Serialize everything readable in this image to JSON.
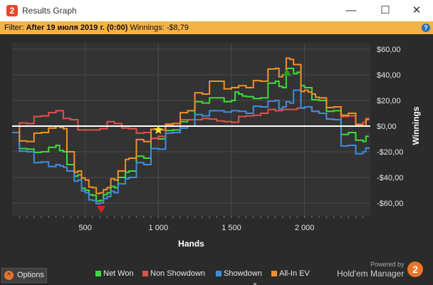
{
  "window": {
    "icon_label": "2",
    "title": "Results Graph",
    "minimize_glyph": "—",
    "maximize_glyph": "☐",
    "close_glyph": "✕"
  },
  "filter_bar": {
    "prefix": "Filter: ",
    "filter_value": "After 19 июля 2019 г. (0:00)",
    "winnings_label": " Winnings: ",
    "winnings_value": "-$8,79",
    "help_glyph": "?"
  },
  "options": {
    "label": "Options",
    "icon_glyph": "^"
  },
  "legend": [
    {
      "name": "Net Won",
      "color": "#3ddc3d"
    },
    {
      "name": "Non Showdown",
      "color": "#e0504a"
    },
    {
      "name": "Showdown",
      "color": "#3c8ee0"
    },
    {
      "name": "All-In EV",
      "color": "#f0902a"
    }
  ],
  "branding": {
    "powered_by": "Powered by",
    "product": "Hold'em Manager",
    "logo_glyph": "2"
  },
  "chart_data": {
    "type": "line",
    "xlabel": "Hands",
    "ylabel": "Winnings",
    "x_ticks": [
      500,
      1000,
      1500,
      2000
    ],
    "x_tick_labels": [
      "500",
      "1 000",
      "1 500",
      "2 000"
    ],
    "xlim": [
      0,
      2450
    ],
    "y_ticks": [
      60,
      40,
      20,
      0,
      -20,
      -40,
      -60
    ],
    "y_tick_labels": [
      "$60,00",
      "$40,00",
      "$20,00",
      "$0,00",
      "-$20,00",
      "-$40,00",
      "-$60,00"
    ],
    "ylim": [
      -70,
      65
    ],
    "grid": true,
    "zero_line": true,
    "series": [
      {
        "name": "Net Won",
        "color": "#3ddc3d",
        "x": [
          0,
          100,
          200,
          300,
          350,
          400,
          450,
          500,
          550,
          600,
          650,
          700,
          750,
          800,
          900,
          1000,
          1100,
          1200,
          1300,
          1400,
          1500,
          1550,
          1600,
          1700,
          1800,
          1850,
          1900,
          1950,
          2000,
          2100,
          2200,
          2300,
          2400,
          2440
        ],
        "y": [
          -5,
          -18,
          -20,
          -15,
          -20,
          -30,
          -38,
          -50,
          -54,
          -58,
          -52,
          -48,
          -40,
          -35,
          -25,
          -10,
          -3,
          5,
          18,
          22,
          20,
          25,
          23,
          22,
          35,
          30,
          45,
          42,
          30,
          20,
          12,
          -5,
          -12,
          -8
        ]
      },
      {
        "name": "Non Showdown",
        "color": "#e0504a",
        "x": [
          0,
          100,
          200,
          300,
          400,
          500,
          600,
          700,
          800,
          900,
          1000,
          1100,
          1200,
          1300,
          1400,
          1500,
          1600,
          1700,
          1800,
          1900,
          2000,
          2100,
          2200,
          2300,
          2400,
          2440
        ],
        "y": [
          0,
          2,
          8,
          12,
          5,
          -3,
          -2,
          2,
          -2,
          -5,
          -8,
          0,
          5,
          6,
          4,
          3,
          8,
          10,
          12,
          13,
          15,
          10,
          5,
          8,
          3,
          5
        ]
      },
      {
        "name": "Showdown",
        "color": "#3c8ee0",
        "x": [
          0,
          100,
          200,
          300,
          350,
          400,
          450,
          500,
          550,
          600,
          650,
          700,
          750,
          800,
          900,
          1000,
          1100,
          1200,
          1300,
          1400,
          1500,
          1600,
          1700,
          1800,
          1850,
          1900,
          1950,
          2000,
          2100,
          2200,
          2300,
          2400,
          2440
        ],
        "y": [
          -5,
          -20,
          -28,
          -30,
          -32,
          -35,
          -42,
          -52,
          -58,
          -60,
          -55,
          -52,
          -45,
          -40,
          -30,
          -18,
          -5,
          0,
          8,
          12,
          12,
          10,
          15,
          20,
          15,
          18,
          28,
          15,
          10,
          5,
          -15,
          -20,
          -18
        ]
      },
      {
        "name": "All-In EV",
        "color": "#f0902a",
        "x": [
          0,
          100,
          200,
          300,
          350,
          400,
          450,
          500,
          550,
          600,
          650,
          700,
          750,
          800,
          900,
          1000,
          1100,
          1200,
          1300,
          1400,
          1500,
          1600,
          1700,
          1800,
          1850,
          1900,
          1950,
          2000,
          2050,
          2100,
          2200,
          2300,
          2400,
          2440
        ],
        "y": [
          0,
          -12,
          -5,
          0,
          -2,
          -20,
          -35,
          -42,
          -48,
          -52,
          -48,
          -42,
          -35,
          -25,
          -12,
          -3,
          2,
          12,
          25,
          35,
          30,
          30,
          35,
          45,
          40,
          52,
          48,
          28,
          25,
          22,
          15,
          10,
          0,
          5
        ]
      }
    ],
    "markers": [
      {
        "kind": "min",
        "x": 610,
        "y": -65,
        "color": "#e02020"
      },
      {
        "kind": "milestone",
        "x": 1000,
        "y": -3,
        "color": "#f5e02a"
      },
      {
        "kind": "max",
        "x": 1880,
        "y": 42,
        "color": "#2a9a2a"
      }
    ]
  }
}
